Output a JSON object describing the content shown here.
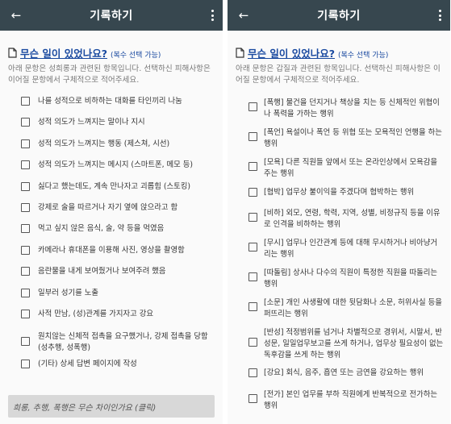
{
  "left": {
    "title": "기록하기",
    "back_icon": "←",
    "question": "무슨 일이 있었나요?",
    "multi": "(복수 선택 가능)",
    "description": "아래 문항은 성희롱과 관련된 항목입니다. 선택하신 피해사항은 이어질 문항에서 구체적으로 적어주세요.",
    "items": [
      "나를 성적으로 비하하는 대화를 타인끼리 나눔",
      "성적 의도가 느껴지는 말이나 지시",
      "성적 의도가 느껴지는 행동 (제스쳐, 시선)",
      "성적 의도가 느껴지는 메시지 (스마트폰, 메모 등)",
      "싫다고 했는데도, 계속 만나자고 괴롭힘 (스토킹)",
      "강제로 술을 따르거나 자기 옆에 앉으라고 함",
      "먹고 싶지 않은 음식, 술, 약 등을 먹였음",
      "카메라나 휴대폰을 이용해 사진, 영상을 촬영함",
      "음란물을 내게 보여줬거나 보여주려 했음",
      "일부러 성기를 노출",
      "사적 만남, (성)관계를 가지자고 강요",
      "원치않는 신체적 접촉을 요구했거나, 강제 접촉을 당함 (성추행, 성폭행)",
      "(기타) 상세 답변 페이지에 작성"
    ],
    "footer": "희롱, 추행, 폭행은 무슨 차이인가요 (클릭)"
  },
  "right": {
    "title": "기록하기",
    "back_icon": "←",
    "question": "무슨 일이 있었나요?",
    "multi": "(복수 선택 가능)",
    "description": "아래 문항은 갑질과 관련된 항목입니다. 선택하신 피해사항은 이어질 문항에서 구체적으로 적어주세요.",
    "items": [
      "[폭행] 물건을 던지거나 책상을 치는 등 신체적인 위협이나 폭력을 가하는 행위",
      "[폭언] 욕설이나 폭언 등 위협 또는 모욕적인 언행을 하는 행위",
      "[모욕] 다른 직원들 앞에서 또는 온라인상에서 모욕감을 주는 행위",
      "[협박] 업무상 불이익을 주겠다며 협박하는 행위",
      "[비하] 외모, 연령, 학력, 지역, 성별, 비정규직 등을 이유로 인격을 비하하는 행위",
      "[무시] 업무나 인간관계 등에 대해 무시하거나 비아냥거리는 행위",
      "[따돌림] 상사나 다수의 직원이 특정한 직원을 따돌리는 행위",
      "[소문] 개인 사생활에 대한 뒷담화나 소문, 허위사실 등을 퍼뜨리는 행위",
      "[반성] 적정범위를 넘거나 차별적으로 경위서, 시말서, 반성문, 일일업무보고를 쓰게 하거나, 업무상 필요성이 없는 독후감을 쓰게 하는 행위",
      "[강요] 회식, 음주, 흡연 또는 금연을 강요하는 행위",
      "[전가] 본인 업무를 부하 직원에게 반복적으로 전가하는 행위"
    ]
  }
}
